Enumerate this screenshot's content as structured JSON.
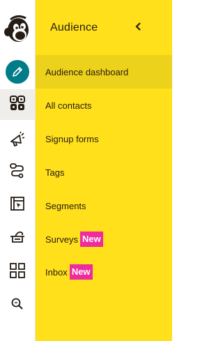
{
  "rail": {
    "logo": "mailchimp-freddie-logo",
    "items": [
      {
        "name": "create",
        "icon": "pencil-icon"
      },
      {
        "name": "audience",
        "icon": "audience-icon",
        "active": true
      },
      {
        "name": "campaigns",
        "icon": "megaphone-icon"
      },
      {
        "name": "automations",
        "icon": "automation-flow-icon"
      },
      {
        "name": "website",
        "icon": "website-icon"
      },
      {
        "name": "content",
        "icon": "content-studio-icon"
      },
      {
        "name": "integrations",
        "icon": "grid-icon"
      },
      {
        "name": "search",
        "icon": "search-icon"
      }
    ]
  },
  "panel": {
    "title": "Audience",
    "collapse_icon": "chevron-left-icon",
    "items": [
      {
        "label": "Audience dashboard",
        "active": true
      },
      {
        "label": "All contacts"
      },
      {
        "label": "Signup forms"
      },
      {
        "label": "Tags"
      },
      {
        "label": "Segments"
      },
      {
        "label": "Surveys",
        "badge": "New"
      },
      {
        "label": "Inbox",
        "badge": "New"
      }
    ]
  },
  "colors": {
    "panel_bg": "#ffe01b",
    "active_bg": "#ecd21a",
    "badge_bg": "#ee2c9c",
    "create_button": "#007c89",
    "text": "#241c15"
  }
}
